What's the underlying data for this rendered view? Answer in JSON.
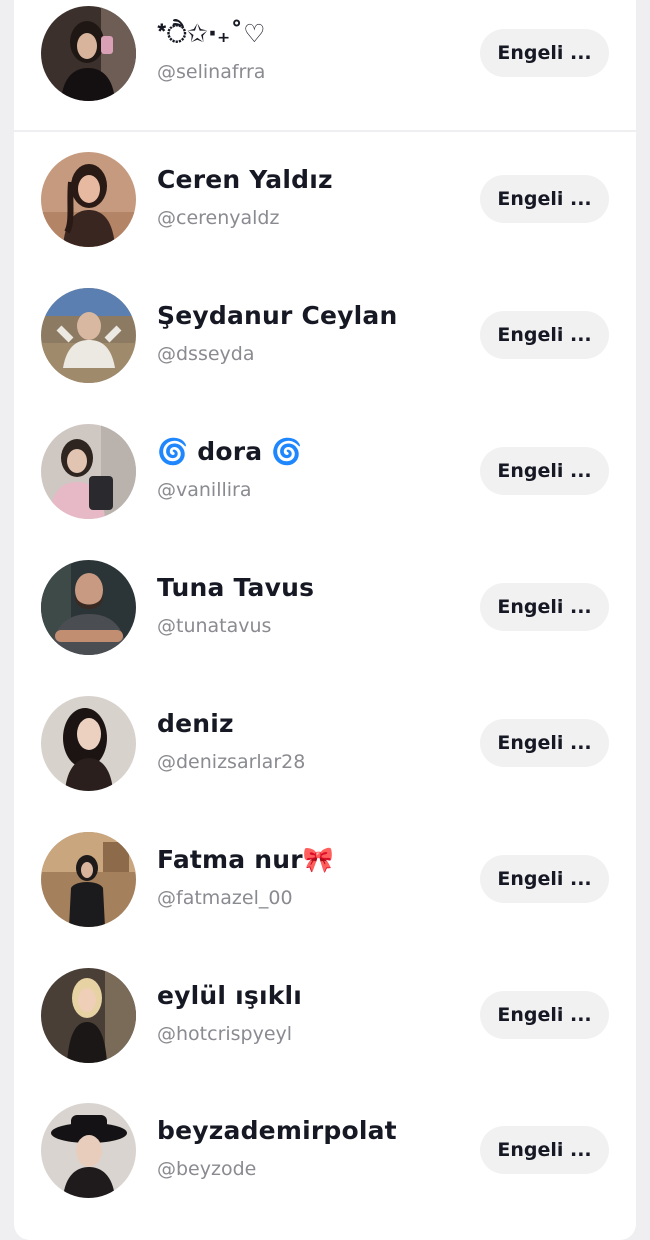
{
  "blocked_accounts": [
    {
      "name": "*ੈ✩‧₊˚♡",
      "handle": "@selinafrra",
      "button_label": "Engeli ...",
      "avatar_icon": "avatar-photo"
    },
    {
      "name": "Ceren Yaldız",
      "handle": "@cerenyaldz",
      "button_label": "Engeli ...",
      "avatar_icon": "avatar-photo"
    },
    {
      "name": "Şeydanur Ceylan",
      "handle": "@dsseyda",
      "button_label": "Engeli ...",
      "avatar_icon": "avatar-photo"
    },
    {
      "name": "🌀 dora 🌀",
      "handle": "@vanillira",
      "button_label": "Engeli ...",
      "avatar_icon": "avatar-photo"
    },
    {
      "name": "Tuna Tavus",
      "handle": "@tunatavus",
      "button_label": "Engeli ...",
      "avatar_icon": "avatar-photo"
    },
    {
      "name": "deniz",
      "handle": "@denizsarlar28",
      "button_label": "Engeli ...",
      "avatar_icon": "avatar-photo"
    },
    {
      "name": "Fatma nur🎀",
      "handle": "@fatmazel_00",
      "button_label": "Engeli ...",
      "avatar_icon": "avatar-photo"
    },
    {
      "name": "eylül ışıklı",
      "handle": "@hotcrispyeyl",
      "button_label": "Engeli ...",
      "avatar_icon": "avatar-photo"
    },
    {
      "name": "beyzademirpolat",
      "handle": "@beyzode",
      "button_label": "Engeli ...",
      "avatar_icon": "avatar-photo"
    }
  ],
  "colors": {
    "background": "#efeff1",
    "card": "#ffffff",
    "name_text": "#161823",
    "handle_text": "#8a8b91",
    "button_bg": "#f1f1f2"
  }
}
